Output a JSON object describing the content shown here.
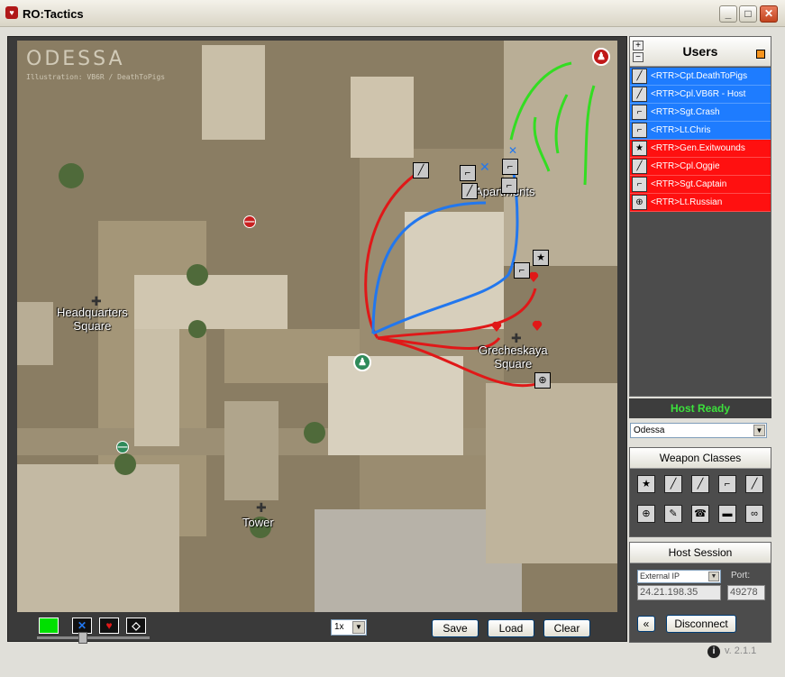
{
  "window": {
    "title": "RO:Tactics",
    "icon": "app-logo-icon",
    "controls": {
      "minimize": "_",
      "maximize": "□",
      "close": "✕"
    }
  },
  "map": {
    "title": "ODESSA",
    "credit": "Illustration: VB6R / DeathToPigs",
    "labels": {
      "apartments": "Apartments",
      "hq_line1": "Headquarters",
      "hq_line2": "Square",
      "grech_line1": "Grecheskaya",
      "grech_line2": "Square",
      "tower": "Tower"
    },
    "colors": {
      "red_team": "#e01818",
      "blue_team": "#2277ee",
      "draw": "#33dd22"
    }
  },
  "toolbar": {
    "tools": [
      "pen-green",
      "blue-x-marker",
      "red-heart-marker",
      "eraser"
    ],
    "tool_color": "#00e000",
    "zoom_value": "1x",
    "save_label": "Save",
    "load_label": "Load",
    "clear_label": "Clear"
  },
  "users": {
    "header": "Users",
    "plus": "+",
    "minus": "−",
    "list": [
      {
        "name": "<RTR>Cpt.DeathToPigs",
        "team": "blue",
        "icon": "sniper-rifle-icon"
      },
      {
        "name": "<RTR>Cpl.VB6R - Host",
        "team": "blue",
        "icon": "rifle-icon"
      },
      {
        "name": "<RTR>Sgt.Crash",
        "team": "blue",
        "icon": "smg-icon"
      },
      {
        "name": "<RTR>Lt.Chris",
        "team": "blue",
        "icon": "smg-icon"
      },
      {
        "name": "<RTR>Gen.Exitwounds",
        "team": "red",
        "icon": "star-icon"
      },
      {
        "name": "<RTR>Cpl.Oggie",
        "team": "red",
        "icon": "rifle-icon"
      },
      {
        "name": "<RTR>Sgt.Captain",
        "team": "red",
        "icon": "smg-icon"
      },
      {
        "name": "<RTR>Lt.Russian",
        "team": "red",
        "icon": "crosshair-icon"
      }
    ],
    "team_colors": {
      "blue": "#1e7cff",
      "red": "#ff1010"
    }
  },
  "status": {
    "host_ready": "Host Ready"
  },
  "map_select": {
    "value": "Odessa"
  },
  "weapon_classes": {
    "header": "Weapon Classes",
    "items": [
      {
        "icon": "star-icon",
        "glyph": "★"
      },
      {
        "icon": "rifle-icon",
        "glyph": "╱"
      },
      {
        "icon": "rifle-alt-icon",
        "glyph": "╱"
      },
      {
        "icon": "smg-icon",
        "glyph": "⌐"
      },
      {
        "icon": "sniper-rifle-icon",
        "glyph": "╱"
      },
      {
        "icon": "crosshair-icon",
        "glyph": "⊕"
      },
      {
        "icon": "engineer-icon",
        "glyph": "✎"
      },
      {
        "icon": "radio-icon",
        "glyph": "☎"
      },
      {
        "icon": "tank-icon",
        "glyph": "▬"
      },
      {
        "icon": "binoculars-icon",
        "glyph": "∞"
      }
    ]
  },
  "host_session": {
    "header": "Host Session",
    "ip_type": "External IP",
    "ip_value": "24.21.198.35",
    "port_label": "Port:",
    "port_value": "49278",
    "back_label": "«",
    "disconnect_label": "Disconnect"
  },
  "version": "v. 2.1.1"
}
